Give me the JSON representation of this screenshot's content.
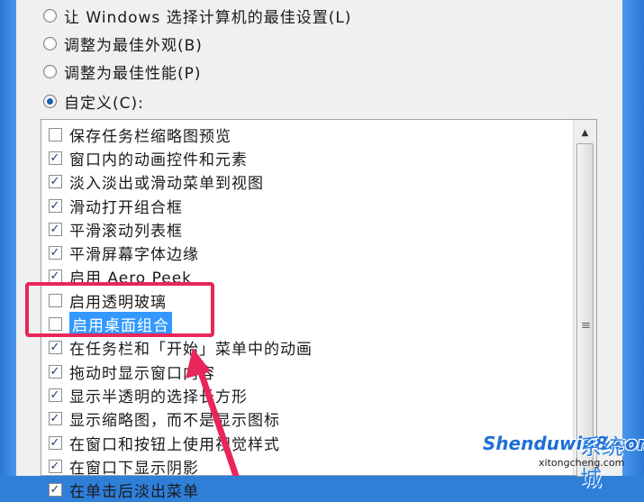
{
  "options": [
    {
      "label": "让 Windows 选择计算机的最佳设置(L)",
      "checked": false
    },
    {
      "label": "调整为最佳外观(B)",
      "checked": false
    },
    {
      "label": "调整为最佳性能(P)",
      "checked": false
    },
    {
      "label": "自定义(C):",
      "checked": true
    }
  ],
  "effects": [
    {
      "label": "保存任务栏缩略图预览",
      "checked": false
    },
    {
      "label": "窗口内的动画控件和元素",
      "checked": true
    },
    {
      "label": "淡入淡出或滑动菜单到视图",
      "checked": true
    },
    {
      "label": "滑动打开组合框",
      "checked": true
    },
    {
      "label": "平滑滚动列表框",
      "checked": true
    },
    {
      "label": "平滑屏幕字体边缘",
      "checked": true
    },
    {
      "label": "启用 Aero Peek",
      "checked": true
    },
    {
      "label": "启用透明玻璃",
      "checked": false
    },
    {
      "label": "启用桌面组合",
      "checked": false,
      "selected": true
    },
    {
      "label": "在任务栏和「开始」菜单中的动画",
      "checked": true
    },
    {
      "label": "拖动时显示窗口内容",
      "checked": true
    },
    {
      "label": "显示半透明的选择长方形",
      "checked": true
    },
    {
      "label": "显示缩略图，而不是显示图标",
      "checked": true
    },
    {
      "label": "在窗口和按钮上使用视觉样式",
      "checked": true
    },
    {
      "label": "在窗口下显示阴影",
      "checked": true
    },
    {
      "label": "在单击后淡出菜单",
      "checked": true
    }
  ],
  "scrollbar": {
    "up_glyph": "▲",
    "grip_glyph": "≡"
  },
  "watermark": {
    "brand": "Shenduwin8.com",
    "cn": "系统城",
    "domain": "xitongcheng.com"
  },
  "colors": {
    "highlight": "#e8265a",
    "selection": "#3399ff"
  }
}
